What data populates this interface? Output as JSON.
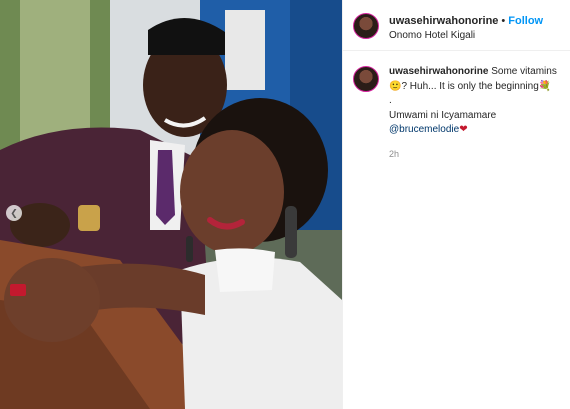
{
  "post": {
    "username": "uwasehirwahonorine",
    "dot": "•",
    "follow_label": "Follow",
    "location": "Onomo Hotel Kigali"
  },
  "caption": {
    "username": "uwasehirwahonorine",
    "line1": "Some vitamins",
    "emoji_smile": "🙂",
    "line2": "? Huh... It is only the beginning",
    "emoji_bouquet": "💐",
    "line3": ".",
    "line4": "Umwami ni Icyamamare",
    "mention": "@brucemelodie",
    "emoji_heart": "❤",
    "time": "2h"
  },
  "icons": {
    "carousel_prev": "chevron-left-icon"
  },
  "colors": {
    "link_blue": "#0095f6",
    "mention_blue": "#00376b",
    "muted": "#8e8e8e"
  }
}
